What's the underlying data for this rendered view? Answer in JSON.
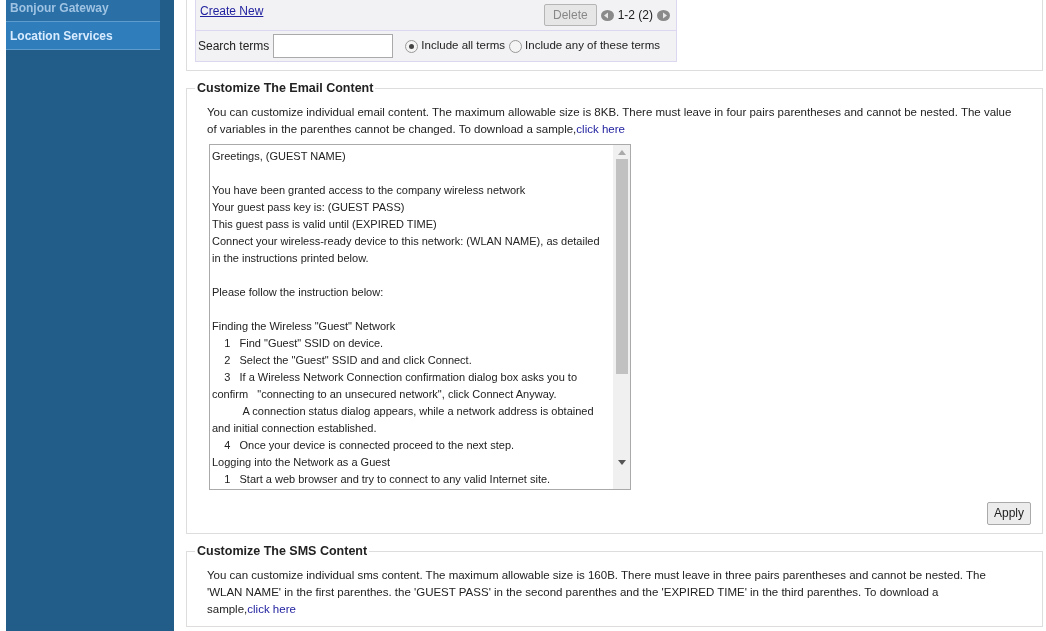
{
  "sidebar": {
    "items": [
      {
        "label": "Bonjour Gateway",
        "selected": false
      },
      {
        "label": "Location Services",
        "selected": true
      }
    ]
  },
  "list_panel": {
    "create_link": "Create New",
    "delete_button": {
      "label": "Delete",
      "disabled": true
    },
    "pager": "1-2 (2)",
    "search": {
      "label": "Search terms"
    },
    "options": [
      {
        "label": "Include all terms",
        "selected": true
      },
      {
        "label": "Include any of these terms",
        "selected": false
      }
    ]
  },
  "email_section": {
    "title": "Customize The Email Content",
    "description": "You can customize individual email content. The maximum allowable size is 8KB. There must leave in four pairs parentheses and cannot be nested. The value of variables in the parenthes cannot be changed. To download a sample,",
    "link": "click here",
    "content_blocks": [
      [
        "Greetings, (GUEST NAME)"
      ],
      [
        "You have been granted access to the company wireless network",
        "Your guest pass key is: (GUEST PASS)",
        "This guest pass is valid until (EXPIRED TIME)",
        "Connect your wireless-ready device to this network: (WLAN NAME), as detailed in the instructions printed below."
      ],
      [
        "Please follow the instruction below:"
      ],
      [
        "Finding the Wireless \"Guest\" Network",
        "    1   Find \"Guest\" SSID on device.",
        "    2   Select the \"Guest\" SSID and and click Connect.",
        "    3   If a Wireless Network Connection confirmation dialog box asks you to confirm   \"connecting to an unsecured network\", click Connect Anyway.",
        "          A connection status dialog appears, while a network address is obtained and initial connection established.",
        "    4   Once your device is connected proceed to the next step.",
        "Logging into the Network as a Guest",
        "    1   Start a web browser and try to connect to any valid Internet site."
      ]
    ],
    "apply_button": "Apply"
  },
  "sms_section": {
    "title": "Customize The SMS Content",
    "description": "You can customize individual sms content. The maximum allowable size is 160B. There must leave in three pairs parentheses and cannot be nested. The 'WLAN NAME' in the first parenthes. the 'GUEST PASS' in the second parenthes and the 'EXPIRED TIME' in the third parenthes. To download a sample,",
    "link": "click here"
  }
}
